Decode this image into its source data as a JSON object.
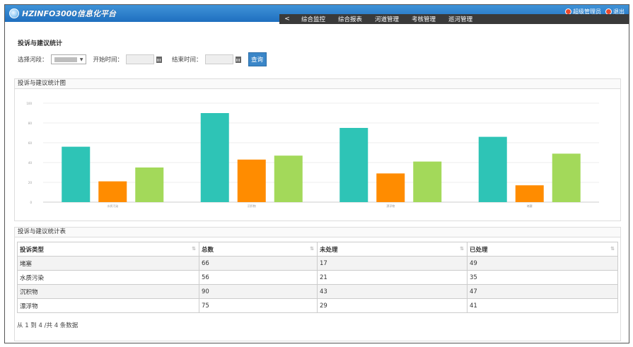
{
  "header": {
    "logo_text": "HZINFO3000信息化平台",
    "user_label": "超级管理员",
    "logout_label": "退出",
    "back_label": "<",
    "nav_items": [
      "综合监控",
      "综合报表",
      "河道管理",
      "考核管理",
      "巡河管理"
    ]
  },
  "page_title": "投诉与建议统计",
  "filters": {
    "river_label": "选择河段：",
    "start_label": "开始时间：",
    "end_label": "结束时间：",
    "query_button": "查询"
  },
  "chart_panel": {
    "title": "投诉与建议统计图"
  },
  "chart_data": {
    "type": "bar",
    "categories": [
      "水质污染",
      "沉积物",
      "漂浮物",
      "堵塞"
    ],
    "series": [
      {
        "values": [
          56,
          90,
          75,
          66
        ],
        "color": "#2ec4b6"
      },
      {
        "values": [
          21,
          43,
          29,
          17
        ],
        "color": "#ff8c00"
      },
      {
        "values": [
          35,
          47,
          41,
          49
        ],
        "color": "#a3d95a"
      }
    ],
    "y_ticks": [
      0,
      20,
      40,
      60,
      80,
      100
    ],
    "ylim": [
      0,
      100
    ],
    "grid": true
  },
  "table_panel": {
    "title": "投诉与建议统计表",
    "columns": [
      "投诉类型",
      "总数",
      "未处理",
      "已处理"
    ],
    "rows": [
      [
        "堵塞",
        "66",
        "17",
        "49"
      ],
      [
        "水质污染",
        "56",
        "21",
        "35"
      ],
      [
        "沉积物",
        "90",
        "43",
        "47"
      ],
      [
        "漂浮物",
        "75",
        "29",
        "41"
      ]
    ],
    "footer": "从 1 到 4 /共 4 条数据"
  }
}
